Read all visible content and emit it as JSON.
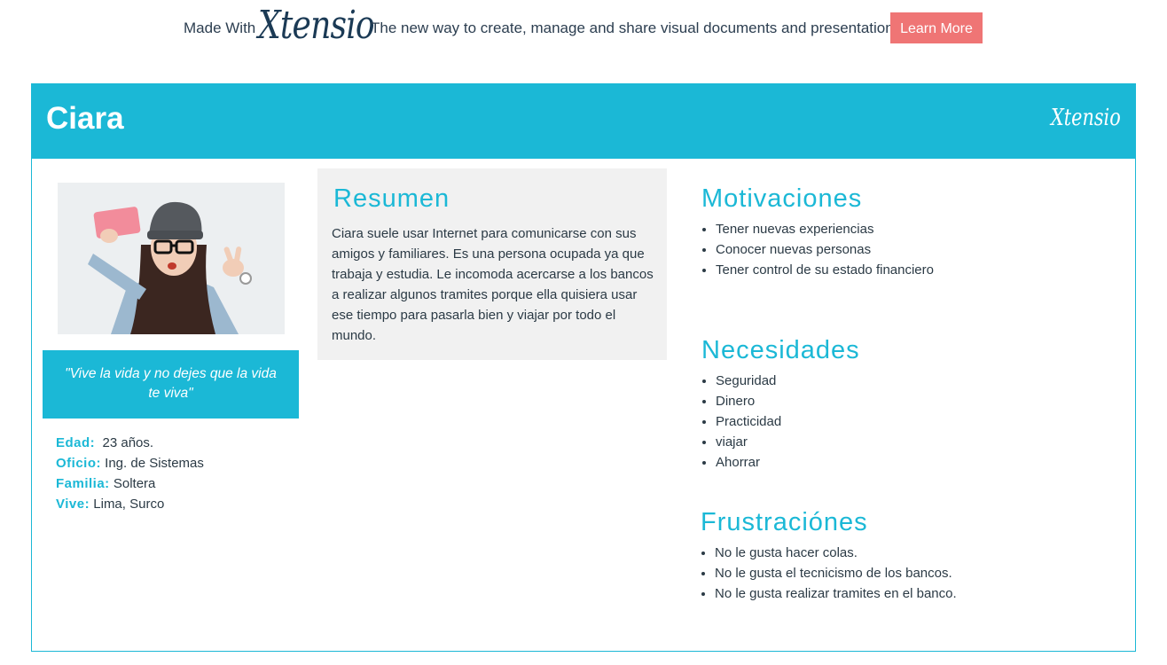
{
  "banner": {
    "made_with": "Made With",
    "logo": "Xtensio",
    "tagline": "The new way to create, manage and share visual documents and presentations.",
    "learn_more": "Learn More"
  },
  "persona": {
    "name": "Ciara",
    "header_logo": "Xtensio",
    "quote": "\"Vive la vida y no dejes que la vida te viva\"",
    "facts": [
      {
        "label": "Edad:",
        "value": "23 años."
      },
      {
        "label": "Oficio:",
        "value": "Ing. de Sistemas"
      },
      {
        "label": "Familia:",
        "value": "Soltera"
      },
      {
        "label": "Vive:",
        "value": "Lima, Surco"
      }
    ]
  },
  "resumen": {
    "title": "Resumen",
    "text": "Ciara suele usar Internet para comunicarse con sus amigos y familiares. Es una persona ocupada ya que trabaja y estudia. Le incomoda acercarse a los bancos a realizar algunos tramites porque ella quisiera usar ese tiempo para pasarla bien y viajar por todo el mundo."
  },
  "motivaciones": {
    "title": "Motivaciones",
    "items": [
      "Tener nuevas experiencias",
      "Conocer nuevas personas",
      "Tener control de su estado financiero"
    ]
  },
  "necesidades": {
    "title": "Necesidades",
    "items": [
      "Seguridad",
      "Dinero",
      "Practicidad",
      "viajar",
      "Ahorrar"
    ]
  },
  "frustraciones": {
    "title": "Frustraciónes",
    "items": [
      "No le gusta hacer colas.",
      "No le gusta el tecnicismo de los bancos.",
      "No le gusta realizar tramites en el banco."
    ]
  },
  "colors": {
    "accent": "#1bb8d6",
    "button": "#ef7575",
    "text": "#2b3a45"
  }
}
